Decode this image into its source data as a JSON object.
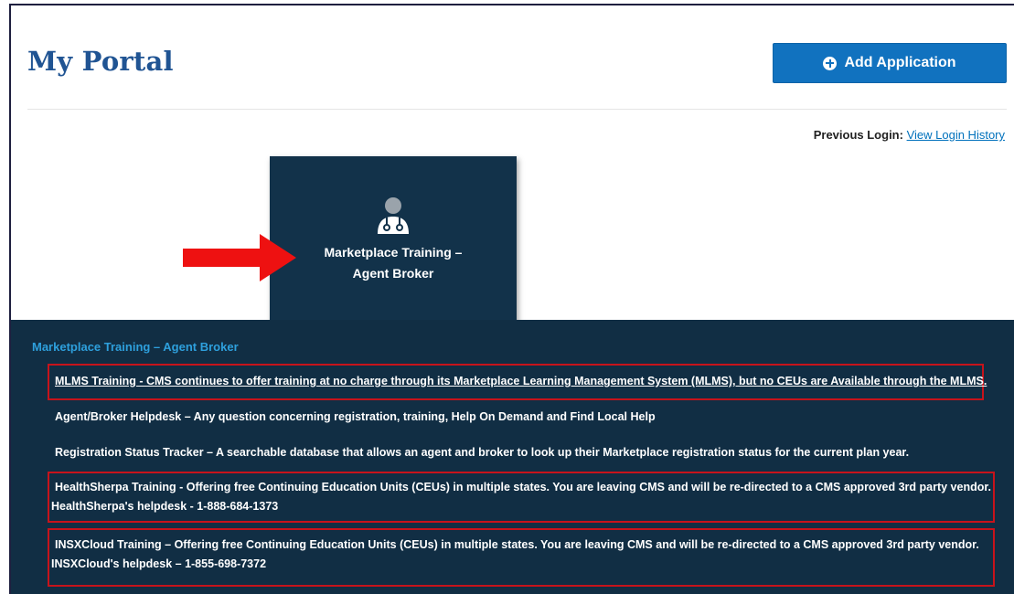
{
  "header": {
    "title": "My Portal",
    "add_button_label": "Add Application"
  },
  "login": {
    "label": "Previous Login:",
    "link": "View Login History"
  },
  "tile": {
    "title": "Marketplace Training –\nAgent Broker",
    "icon": "doctor-user-icon"
  },
  "panel": {
    "title": "Marketplace Training – Agent Broker",
    "items": [
      {
        "text": "MLMS Training - CMS continues to offer training at no charge through its Marketplace Learning Management System (MLMS), but no CEUs are Available through the MLMS."
      },
      {
        "text": "Agent/Broker Helpdesk – Any question concerning registration, training, Help On Demand and Find Local Help"
      },
      {
        "text": "Registration Status Tracker – A searchable database that allows an agent and broker to look up their Marketplace registration status for the current plan year."
      },
      {
        "text": "HealthSherpa Training - Offering free Continuing Education Units (CEUs) in multiple states. You are leaving CMS and will be re-directed to a CMS approved 3rd party vendor.",
        "subtext": "HealthSherpa's helpdesk - 1-888-684-1373"
      },
      {
        "text": "INSXCloud Training – Offering free Continuing Education Units (CEUs) in multiple states. You are leaving CMS and will be re-directed to a CMS approved 3rd party vendor.",
        "subtext": "INSXCloud's helpdesk – 1-855-698-7372"
      }
    ]
  },
  "colors": {
    "title": "#205493",
    "button": "#1172bf",
    "panel": "#112e44",
    "highlight": "#c7131b",
    "arrow": "#ee1111"
  }
}
